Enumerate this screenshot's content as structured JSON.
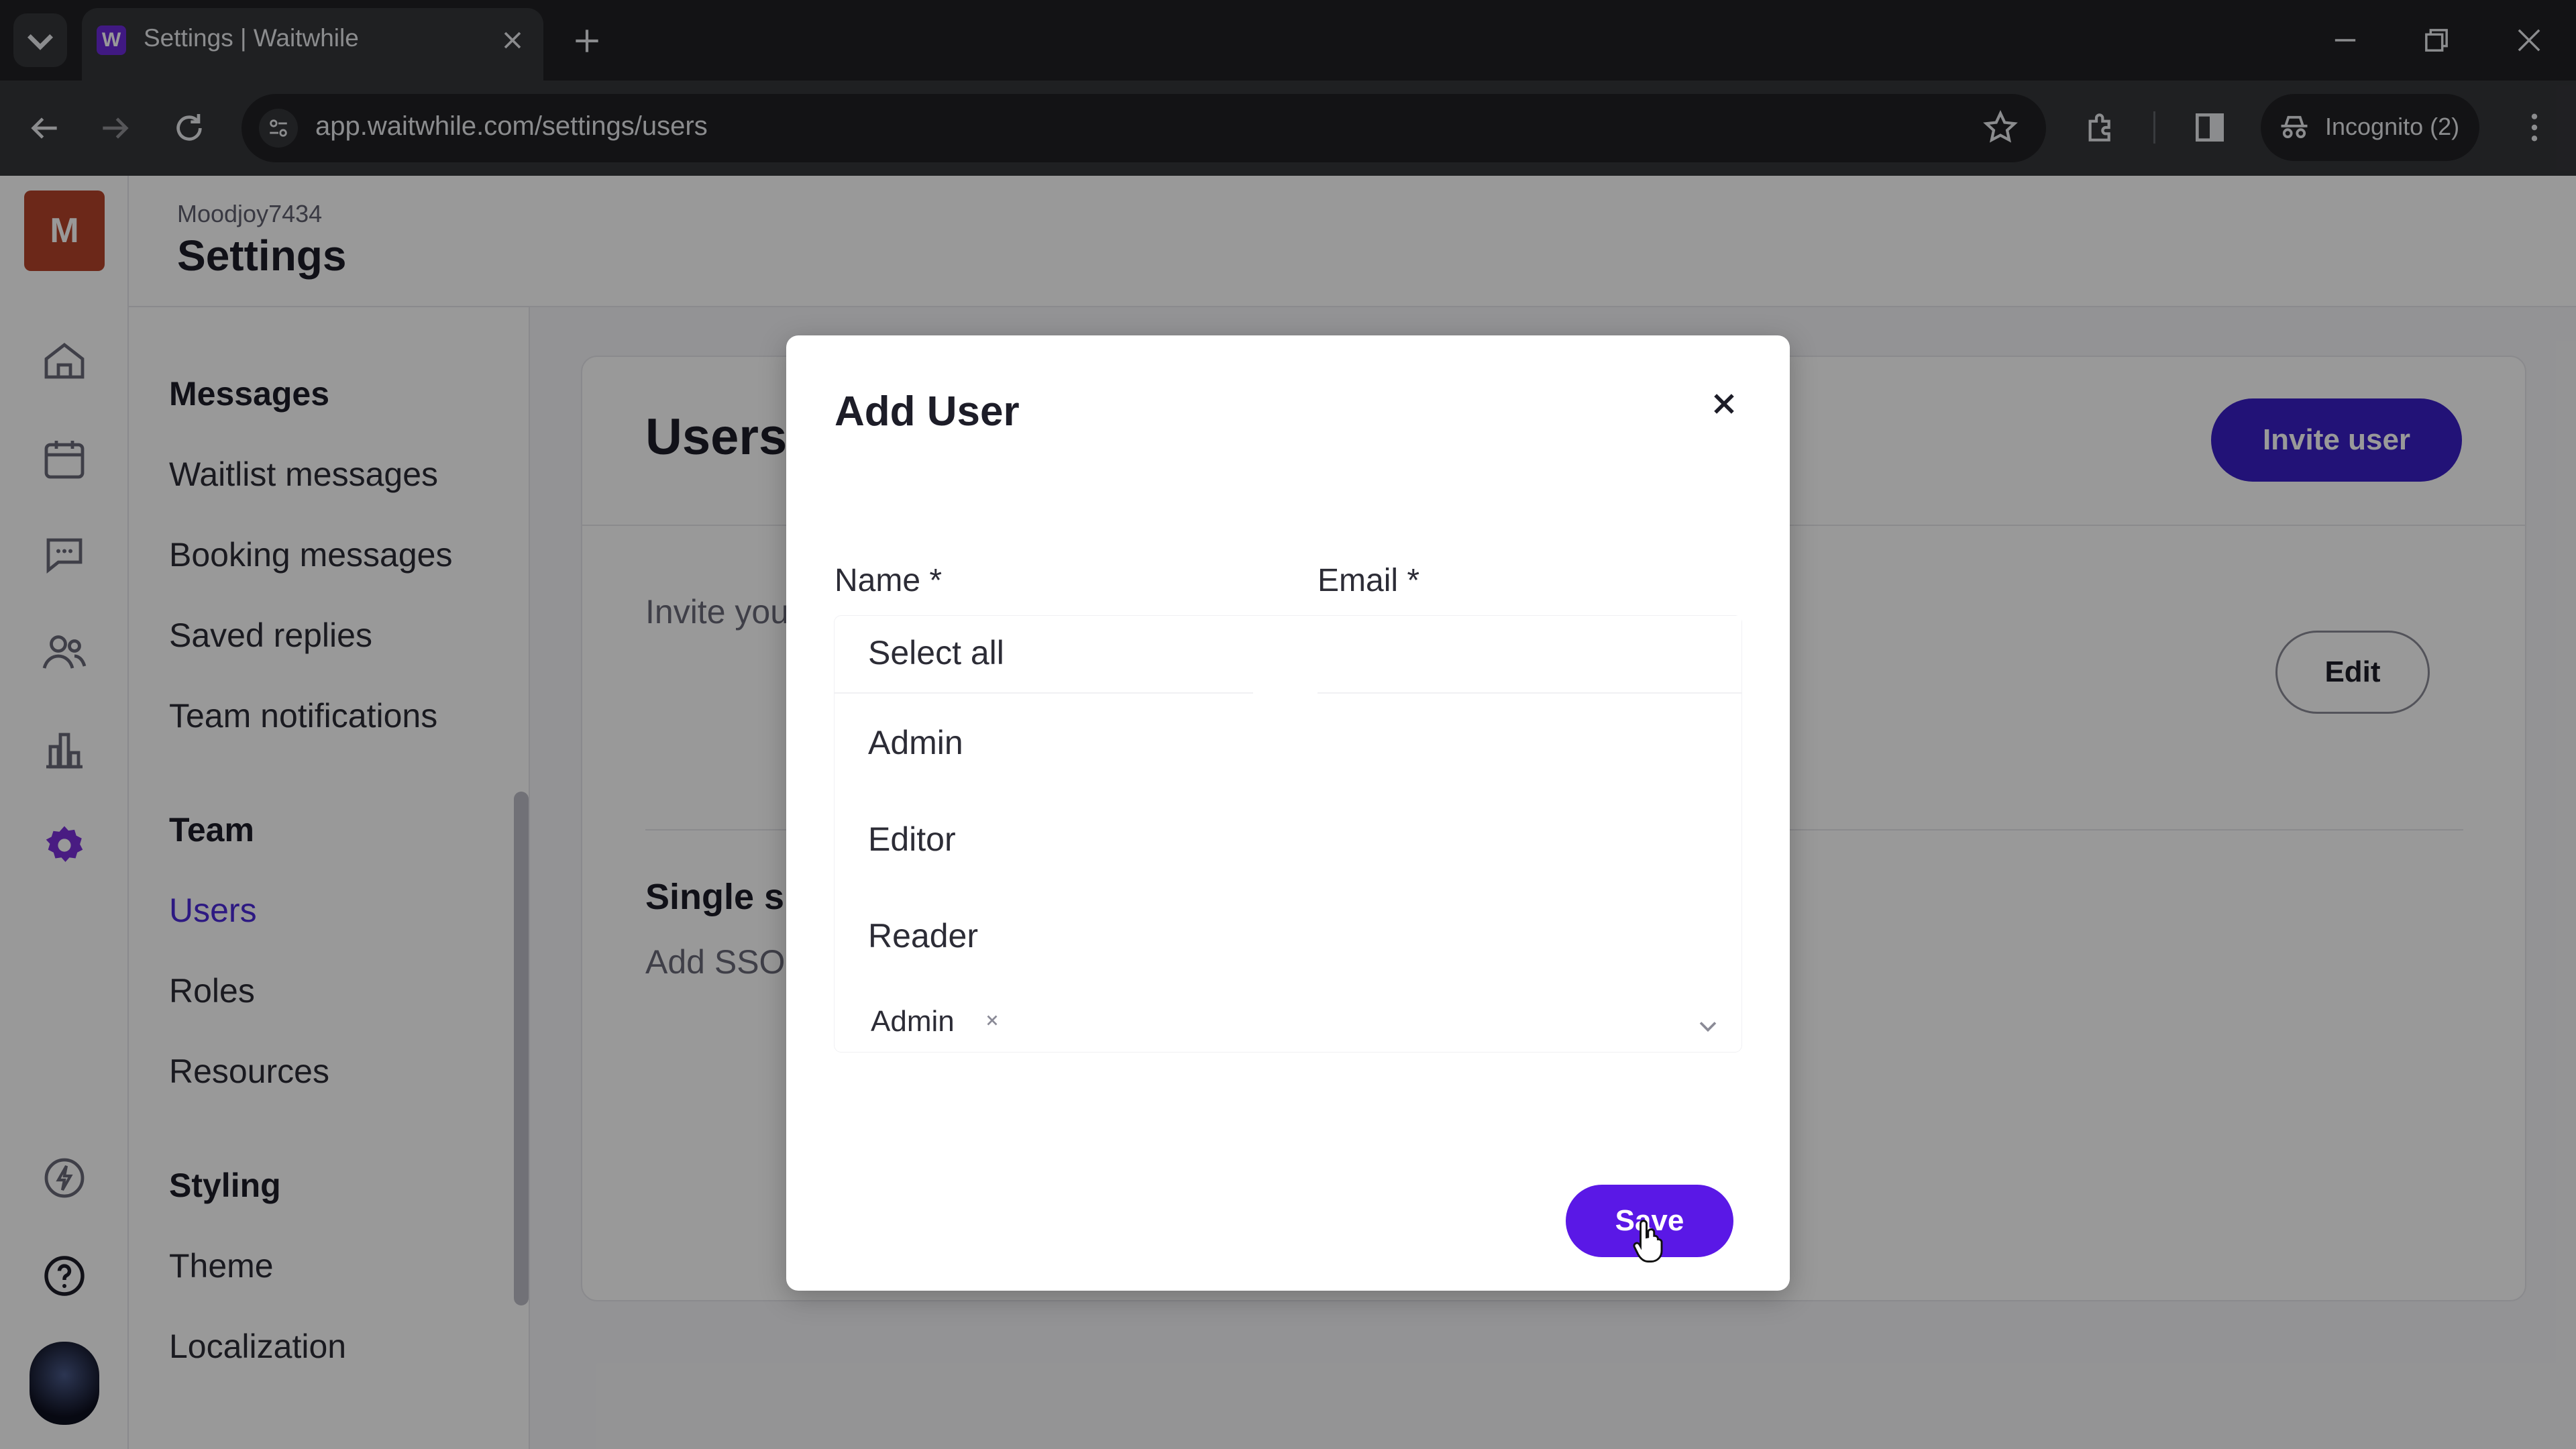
{
  "browser": {
    "tab_title": "Settings | Waitwhile",
    "favicon_letter": "W",
    "url": "app.waitwhile.com/settings/users",
    "incognito_label": "Incognito (2)"
  },
  "app": {
    "org_initial": "M",
    "org_name": "Moodjoy7434",
    "page_title": "Settings"
  },
  "settings_nav": {
    "messages_heading": "Messages",
    "messages_items": [
      "Waitlist messages",
      "Booking messages",
      "Saved replies",
      "Team notifications"
    ],
    "team_heading": "Team",
    "team_items": [
      "Users",
      "Roles",
      "Resources"
    ],
    "styling_heading": "Styling",
    "styling_items": [
      "Theme",
      "Localization"
    ],
    "active_item": "Users"
  },
  "content": {
    "users_heading": "Users",
    "invite_button": "Invite user",
    "users_description": "Invite you access y account",
    "edit_button": "Edit",
    "sso_heading": "Single si",
    "sso_description": "Add SSO security your tean Waitwhile"
  },
  "modal": {
    "title": "Add User",
    "name_label": "Name *",
    "email_label": "Email *",
    "dropdown_options": [
      "Select all",
      "Admin",
      "Editor",
      "Reader"
    ],
    "selected_role": "Admin",
    "save_button": "Save"
  },
  "colors": {
    "accent": "#5a18e6",
    "invite_button": "#3a1fc6",
    "active_nav": "#4b2bd9",
    "org_avatar": "#b5442a",
    "settings_icon": "#6f2bd9"
  }
}
